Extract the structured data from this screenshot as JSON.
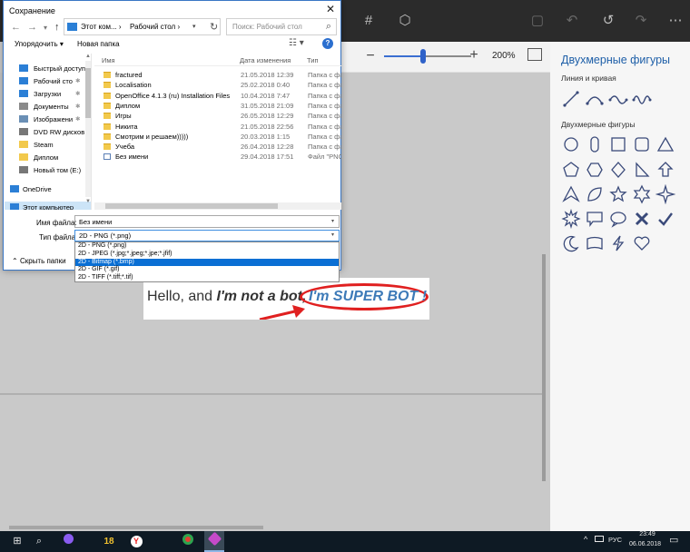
{
  "dialog": {
    "title": "Сохранение",
    "address": [
      "Этот ком...",
      "Рабочий стол"
    ],
    "search_placeholder": "Поиск: Рабочий стол",
    "organize_label": "Упорядочить ▾",
    "new_folder_label": "Новая папка",
    "help_label": "?",
    "nav_items": [
      {
        "label": "Быстрый доступ",
        "icon": "star-icon"
      },
      {
        "label": "Рабочий сто",
        "icon": "desktop-icon"
      },
      {
        "label": "Загрузки",
        "icon": "download-icon"
      },
      {
        "label": "Документы",
        "icon": "documents-icon"
      },
      {
        "label": "Изображени",
        "icon": "pictures-icon"
      },
      {
        "label": "DVD RW дисков",
        "icon": "dvd-icon"
      },
      {
        "label": "Steam",
        "icon": "folder-icon"
      },
      {
        "label": "Диплом",
        "icon": "folder-icon"
      },
      {
        "label": "Новый том (E:)",
        "icon": "drive-icon"
      },
      {
        "label": "OneDrive",
        "icon": "cloud-icon"
      },
      {
        "label": "Этот компьютер",
        "icon": "computer-icon"
      }
    ],
    "columns": {
      "name": "Имя",
      "date": "Дата изменения",
      "type": "Тип"
    },
    "files": [
      {
        "name": "fractured",
        "date": "21.05.2018 12:39",
        "type": "Папка с фай"
      },
      {
        "name": "Localisation",
        "date": "25.02.2018 0:40",
        "type": "Папка с фай"
      },
      {
        "name": "OpenOffice 4.1.3 (ru) Installation Files",
        "date": "10.04.2018 7:47",
        "type": "Папка с фай"
      },
      {
        "name": "Диплом",
        "date": "31.05.2018 21:09",
        "type": "Папка с фай"
      },
      {
        "name": "Игры",
        "date": "26.05.2018 12:29",
        "type": "Папка с фай"
      },
      {
        "name": "Никита",
        "date": "21.05.2018 22:56",
        "type": "Папка с фай"
      },
      {
        "name": "Смотрим и решаем)))))",
        "date": "20.03.2018 1:15",
        "type": "Папка с фай"
      },
      {
        "name": "Учеба",
        "date": "26.04.2018 12:28",
        "type": "Папка с фай"
      },
      {
        "name": "Без имени",
        "date": "29.04.2018 17:51",
        "type": "Файл \"PNG\""
      }
    ],
    "filename_label": "Имя файла:",
    "filename_value": "Без имени",
    "filetype_label": "Тип файла:",
    "filetype_value": "2D - PNG (*.png)",
    "filetype_options": [
      "2D - PNG (*.png)",
      "2D - JPEG (*.jpg;*.jpeg;*.jpe;*.jfif)",
      "2D - Bitmap (*.bmp)",
      "2D - GIF (*.gif)",
      "2D - TIFF (*.tiff;*.tif)"
    ],
    "filetype_selected_index": 2,
    "hide_folders_label": "Скрыть папки"
  },
  "app": {
    "zoom_value": "200%",
    "zoom_fraction": 0.45,
    "canvas": {
      "hello": "Hello, and ",
      "not_a_bot": "I'm not a bot,",
      "super_bot": "I'm SUPER BOT !"
    }
  },
  "panel": {
    "title": "Двухмерные фигуры",
    "lines_heading": "Линия и кривая",
    "shapes_heading": "Двухмерные фигуры",
    "accent_color": "#1e5fa8"
  },
  "taskbar": {
    "lang": "РУС",
    "time": "23:49",
    "date": "06.06.2018",
    "apps": [
      "start-icon",
      "search-icon",
      "torrent-icon",
      "app-18-icon",
      "yandex-icon",
      "chrome-icon",
      "paint3d-icon"
    ]
  }
}
